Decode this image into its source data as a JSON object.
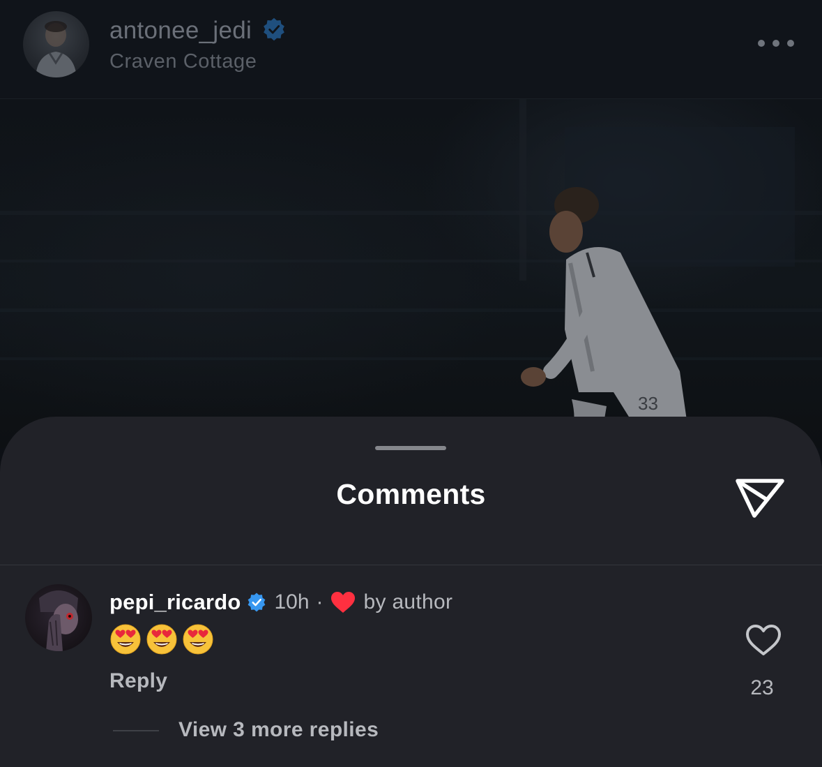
{
  "post": {
    "username": "antonee_jedi",
    "location": "Craven Cottage",
    "verified": true
  },
  "comments_sheet": {
    "title": "Comments"
  },
  "comment": {
    "username": "pepi_ricardo",
    "verified": true,
    "time": "10h",
    "separator": "·",
    "liked_by_author_label": "by author",
    "text_emojis": [
      "heart-eyes-emoji",
      "heart-eyes-emoji",
      "heart-eyes-emoji"
    ],
    "reply_label": "Reply",
    "like_count": "23",
    "view_replies_label": "View 3 more replies"
  },
  "colors": {
    "sheet_background": "#212228",
    "verified_badge": "#3797f0",
    "liked_heart": "#ff3040",
    "secondary_text": "#b7b9be"
  },
  "icons": {
    "more": "more-horizontal-icon",
    "share": "paper-plane-icon",
    "like": "heart-outline-icon",
    "verified": "verified-badge-icon"
  }
}
